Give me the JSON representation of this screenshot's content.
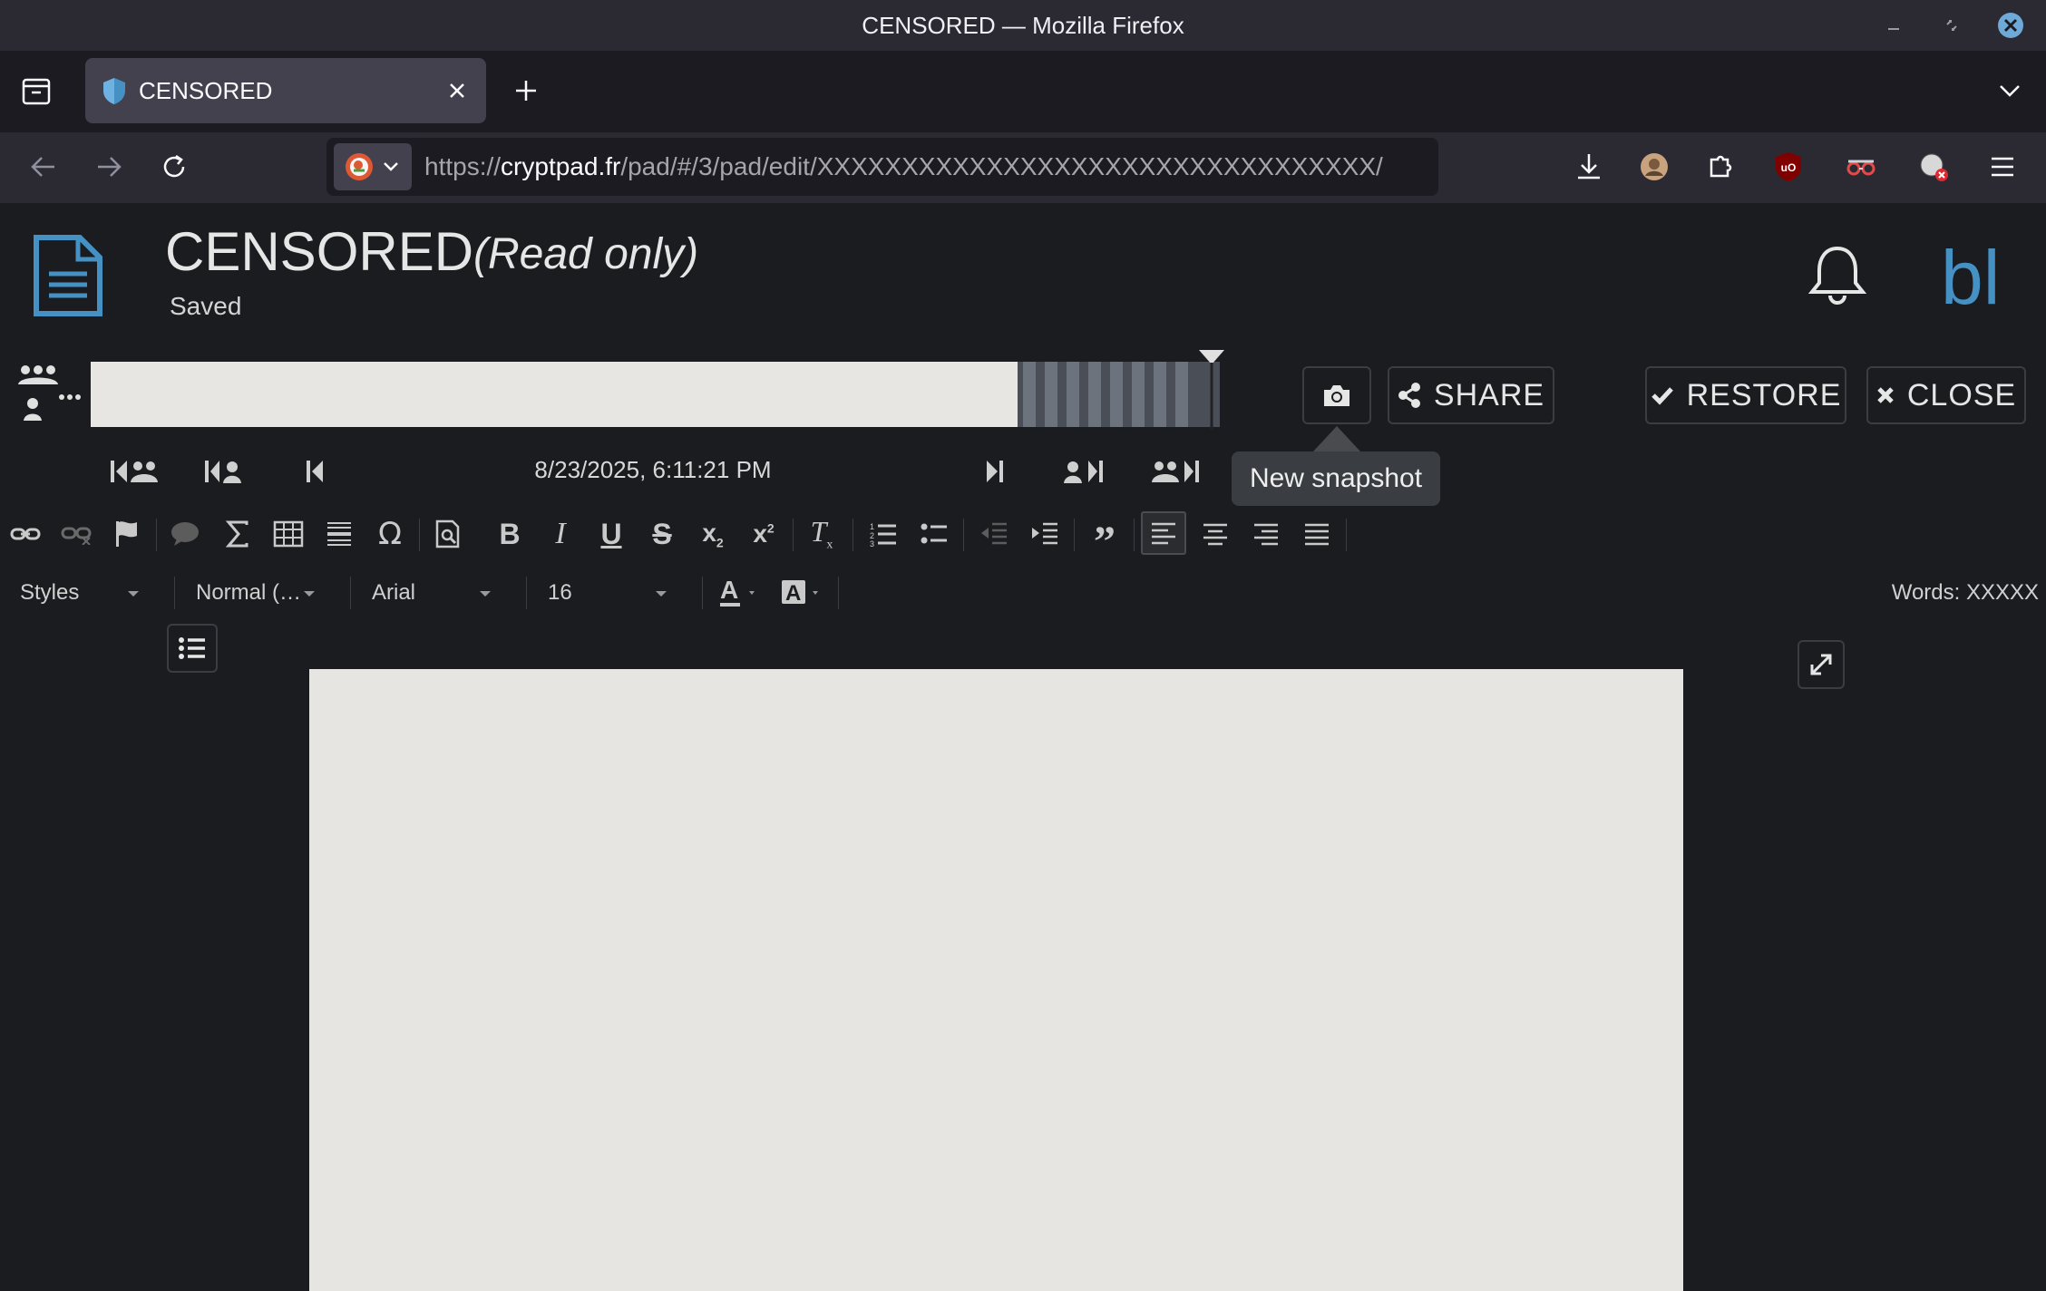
{
  "window": {
    "title": "CENSORED — Mozilla Firefox"
  },
  "browser": {
    "tab_title": "CENSORED",
    "url_scheme": "https://",
    "url_host": "cryptpad.fr",
    "url_path": "/pad/#/3/pad/edit/XXXXXXXXXXXXXXXXXXXXXXXXXXXXXXXXX/"
  },
  "app": {
    "doc_title": "CENSORED",
    "mode_label": "(Read only)",
    "save_status": "Saved",
    "user_initials": "bl"
  },
  "history": {
    "timestamp": "8/23/2025, 6:11:21 PM",
    "share_label": "SHARE",
    "restore_label": "RESTORE",
    "close_label": "CLOSE",
    "snapshot_tooltip": "New snapshot"
  },
  "format": {
    "styles_label": "Styles",
    "paragraph_format": "Normal (…",
    "font_name": "Arial",
    "font_size": "16",
    "word_count": "Words: XXXXX"
  },
  "colors": {
    "accent": "#4591c4",
    "page": "#e6e5e2",
    "background": "#1b1c1f"
  }
}
